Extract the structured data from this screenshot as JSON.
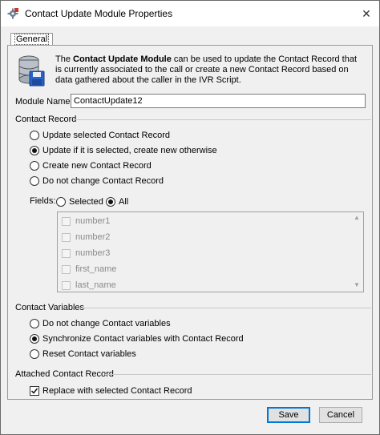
{
  "window": {
    "title": "Contact Update Module Properties",
    "close_glyph": "✕"
  },
  "tabs": [
    {
      "label": "General",
      "selected": true
    }
  ],
  "description": {
    "prefix": "The ",
    "module_bold": "Contact Update Module",
    "rest": " can be used to update the Contact Record that is currently associated to the call or create a new Contact Record based on data gathered about the caller in the IVR Script."
  },
  "module_name": {
    "label": "Module Name:",
    "value": "ContactUpdate12"
  },
  "contact_record": {
    "title": "Contact Record",
    "options": [
      {
        "label": "Update selected Contact Record",
        "selected": false
      },
      {
        "label": "Update if it is selected, create new otherwise",
        "selected": true
      },
      {
        "label": "Create new Contact Record",
        "selected": false
      },
      {
        "label": "Do not change Contact Record",
        "selected": false
      }
    ],
    "fields_label": "Fields:",
    "fields_options": [
      {
        "label": "Selected",
        "selected": false
      },
      {
        "label": "All",
        "selected": true
      }
    ],
    "field_list": [
      {
        "label": "number1",
        "checked": false
      },
      {
        "label": "number2",
        "checked": false
      },
      {
        "label": "number3",
        "checked": false
      },
      {
        "label": "first_name",
        "checked": false
      },
      {
        "label": "last_name",
        "checked": false
      }
    ]
  },
  "contact_variables": {
    "title": "Contact Variables",
    "options": [
      {
        "label": "Do not change Contact variables",
        "selected": false
      },
      {
        "label": "Synchronize Contact variables with Contact Record",
        "selected": true
      },
      {
        "label": "Reset Contact variables",
        "selected": false
      }
    ]
  },
  "attached_contact_record": {
    "title": "Attached Contact Record",
    "replace_label": "Replace with selected Contact Record",
    "replace_checked": true
  },
  "buttons": {
    "save": "Save",
    "cancel": "Cancel"
  },
  "icons": {
    "title": "module-gear-icon",
    "info": "database-disk-icon"
  },
  "colors": {
    "accent": "#0078d7",
    "disabled_text": "#8a8a8a"
  }
}
